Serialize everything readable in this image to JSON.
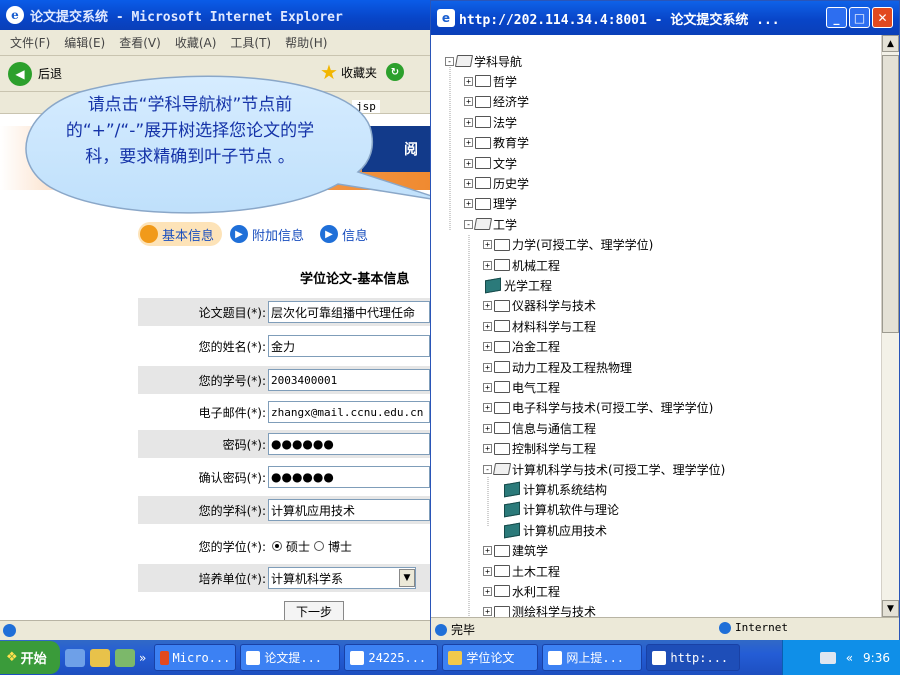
{
  "back_window": {
    "title": "论文提交系统 - Microsoft Internet Explorer",
    "menu": [
      "文件(F)",
      "编辑(E)",
      "查看(V)",
      "收藏(A)",
      "工具(T)",
      "帮助(H)"
    ],
    "back_label": "后退",
    "favorites_label": "收藏夹",
    "address_tail": "jsp",
    "banner_text": "阅"
  },
  "callout": {
    "text": "请点击“学科导航树”节点前的“+”/“-”展开树选择您论文的学科，要求精确到叶子节点 。"
  },
  "form": {
    "tabs": [
      "基本信息",
      "附加信息",
      "信息"
    ],
    "heading": "学位论文-基本信息",
    "rows": [
      {
        "label": "论文题目(*):",
        "value": "层次化可靠组播中代理任命"
      },
      {
        "label": "您的姓名(*):",
        "value": "金力"
      },
      {
        "label": "您的学号(*):",
        "value": "2003400001"
      },
      {
        "label": "电子邮件(*):",
        "value": "zhangx@mail.ccnu.edu.cn"
      },
      {
        "label": "密码(*):",
        "value": "●●●●●●"
      },
      {
        "label": "确认密码(*):",
        "value": "●●●●●●"
      },
      {
        "label": "您的学科(*):",
        "value": "计算机应用技术"
      },
      {
        "label": "您的学位(*):",
        "value": ""
      },
      {
        "label": "培养单位(*):",
        "value": "计算机科学系"
      }
    ],
    "degree_options": [
      "硕士",
      "博士"
    ],
    "next_button": "下一步"
  },
  "popup": {
    "title": "http://202.114.34.4:8001 - 论文提交系统 ...",
    "status": "完毕",
    "zone": "Internet",
    "tree": [
      {
        "label": "学科导航",
        "toggle": "-",
        "kind": "root"
      },
      {
        "label": "哲学",
        "toggle": "+",
        "kind": "folder"
      },
      {
        "label": "经济学",
        "toggle": "+",
        "kind": "folder"
      },
      {
        "label": "法学",
        "toggle": "+",
        "kind": "folder"
      },
      {
        "label": "教育学",
        "toggle": "+",
        "kind": "folder"
      },
      {
        "label": "文学",
        "toggle": "+",
        "kind": "folder"
      },
      {
        "label": "历史学",
        "toggle": "+",
        "kind": "folder"
      },
      {
        "label": "理学",
        "toggle": "+",
        "kind": "folder"
      },
      {
        "label": "工学",
        "toggle": "-",
        "kind": "open"
      },
      {
        "label": "力学(可授工学、理学学位)",
        "toggle": "+",
        "kind": "folder"
      },
      {
        "label": "机械工程",
        "toggle": "+",
        "kind": "folder"
      },
      {
        "label": "光学工程",
        "toggle": "",
        "kind": "leaf"
      },
      {
        "label": "仪器科学与技术",
        "toggle": "+",
        "kind": "folder"
      },
      {
        "label": "材料科学与工程",
        "toggle": "+",
        "kind": "folder"
      },
      {
        "label": "冶金工程",
        "toggle": "+",
        "kind": "folder"
      },
      {
        "label": "动力工程及工程热物理",
        "toggle": "+",
        "kind": "folder"
      },
      {
        "label": "电气工程",
        "toggle": "+",
        "kind": "folder"
      },
      {
        "label": "电子科学与技术(可授工学、理学学位)",
        "toggle": "+",
        "kind": "folder"
      },
      {
        "label": "信息与通信工程",
        "toggle": "+",
        "kind": "folder"
      },
      {
        "label": "控制科学与工程",
        "toggle": "+",
        "kind": "folder"
      },
      {
        "label": "计算机科学与技术(可授工学、理学学位)",
        "toggle": "-",
        "kind": "open"
      },
      {
        "label": "计算机系统结构",
        "toggle": "",
        "kind": "leaf"
      },
      {
        "label": "计算机软件与理论",
        "toggle": "",
        "kind": "leaf"
      },
      {
        "label": "计算机应用技术",
        "toggle": "",
        "kind": "leaf"
      },
      {
        "label": "建筑学",
        "toggle": "+",
        "kind": "folder"
      },
      {
        "label": "土木工程",
        "toggle": "+",
        "kind": "folder"
      },
      {
        "label": "水利工程",
        "toggle": "+",
        "kind": "folder"
      },
      {
        "label": "测绘科学与技术",
        "toggle": "+",
        "kind": "folder"
      }
    ]
  },
  "taskbar": {
    "start": "开始",
    "more": "»",
    "tasks": [
      "Micro...",
      "论文提...",
      "24225...",
      "学位论文",
      "网上提...",
      "http:..."
    ],
    "tray_more": "«",
    "clock": "9:36"
  }
}
